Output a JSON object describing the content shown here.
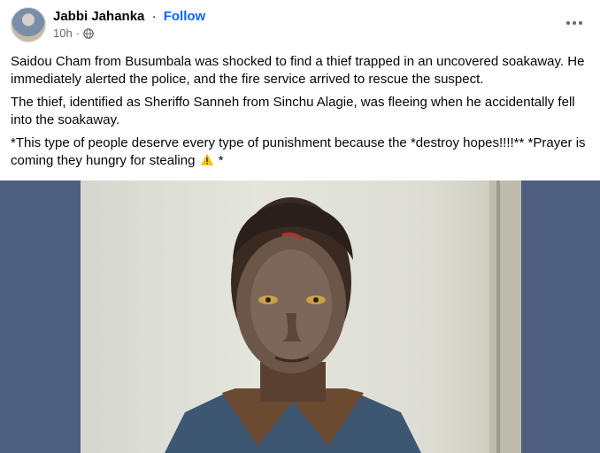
{
  "post": {
    "author": "Jabbi Jahanka",
    "separator": "·",
    "follow_label": "Follow",
    "time": "10h",
    "meta_separator": "·",
    "privacy_icon": "globe-icon",
    "more_icon": "more-options-icon",
    "paragraphs": [
      "Saidou Cham from Busumbala was shocked to find a thief trapped in an uncovered soakaway. He immediately alerted the police, and the fire service arrived to rescue the suspect.",
      "The thief, identified as Sheriffo Sanneh from Sinchu Alagie, was fleeing when he accidentally fell into the soakaway."
    ],
    "last_paragraph_text": " *This type of people deserve every type of punishment because the *destroy hopes!!!!** *Prayer is coming they hungry for stealing",
    "last_paragraph_tail": " *",
    "warning_icon": "warning-icon"
  },
  "colors": {
    "link": "#0866ff",
    "meta": "#65676b",
    "media_background": "#4f5f80"
  }
}
